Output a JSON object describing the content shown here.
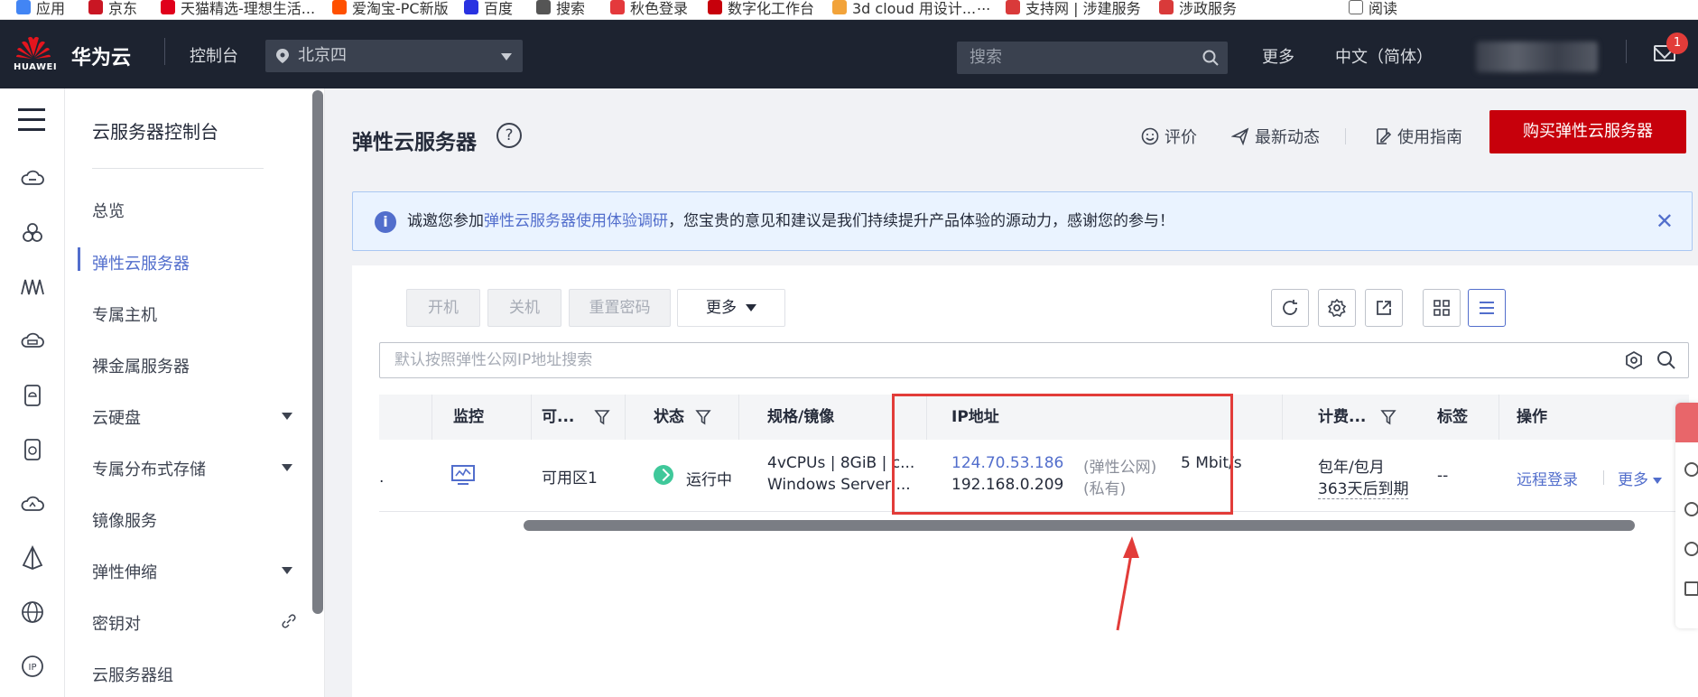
{
  "bookmarks": [
    "应用",
    "京东",
    "天猫精选-理想生活...",
    "爱淘宝-PC新版",
    "百度",
    "搜索",
    "秋色登录",
    "数字化工作台",
    "3d cloud 用设计...",
    "...",
    "支持网 | 涉建服务",
    "涉政服务",
    "阅读"
  ],
  "topbar": {
    "logo_text": "HUAWEI",
    "brand": "华为云",
    "console": "控制台",
    "region": "北京四",
    "search_placeholder": "搜索",
    "more": "更多",
    "language": "中文（简体）",
    "mail_badge": "1"
  },
  "sidebar": {
    "title": "云服务器控制台",
    "items": [
      {
        "label": "总览"
      },
      {
        "label": "弹性云服务器"
      },
      {
        "label": "专属主机"
      },
      {
        "label": "裸金属服务器"
      },
      {
        "label": "云硬盘"
      },
      {
        "label": "专属分布式存储"
      },
      {
        "label": "镜像服务"
      },
      {
        "label": "弹性伸缩"
      },
      {
        "label": "密钥对"
      },
      {
        "label": "云服务器组"
      }
    ]
  },
  "page": {
    "title": "弹性云服务器",
    "help": "?",
    "links": {
      "rate": "评价",
      "news": "最新动态",
      "guide": "使用指南"
    },
    "buy_button": "购买弹性云服务器"
  },
  "notice": {
    "prefix": "诚邀您参加",
    "link": "弹性云服务器使用体验调研",
    "suffix": "，您宝贵的意见和建议是我们持续提升产品体验的源动力，感谢您的参与！",
    "close": "✕"
  },
  "toolbar": {
    "start": "开机",
    "stop": "关机",
    "reset_password": "重置密码",
    "more": "更多"
  },
  "search_box": {
    "placeholder": "默认按照弹性公网IP地址搜索"
  },
  "table": {
    "headers": {
      "monitor": "监控",
      "az": "可...",
      "status": "状态",
      "spec": "规格/镜像",
      "ip": "IP地址",
      "billing": "计费...",
      "tags": "标签",
      "actions": "操作"
    },
    "rows": [
      {
        "name_tail": ".",
        "az": "可用区1",
        "status": "运行中",
        "spec_line1": "4vCPUs | 8GiB | c...",
        "spec_line2": "Windows Server ...",
        "public_ip": "124.70.53.186",
        "public_ip_type": "(弹性公网)",
        "bandwidth": "5 Mbit/s",
        "private_ip": "192.168.0.209",
        "private_ip_type": "(私有)",
        "billing_line1": "包年/包月",
        "billing_line2": "363天后到期",
        "tags": "--",
        "action_login": "远程登录",
        "action_more": "更多"
      }
    ]
  },
  "colors": {
    "topbar_bg": "#1d2330",
    "brand_red": "#c7000b",
    "link_blue": "#526ecc",
    "running_green": "#3fc89a",
    "annotation_red": "#e23c39"
  }
}
